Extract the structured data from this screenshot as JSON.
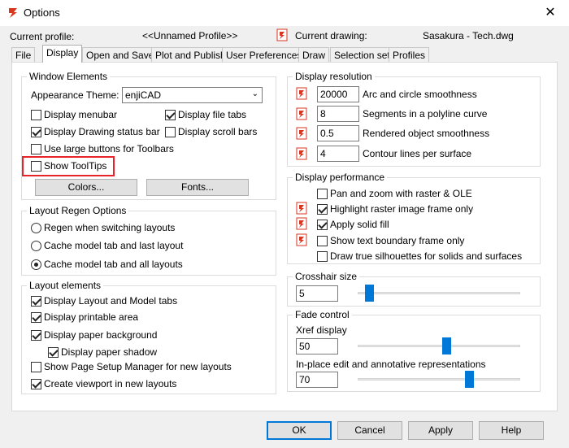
{
  "window": {
    "title": "Options",
    "close_glyph": "✕",
    "icon": "app-logo-icon"
  },
  "profile": {
    "current_profile_label": "Current profile:",
    "current_profile_value": "<<Unnamed Profile>>",
    "current_drawing_label": "Current drawing:",
    "current_drawing_value": "Sasakura - Tech.dwg"
  },
  "tabs": [
    "File",
    "Display",
    "Open and Save",
    "Plot and Publish",
    "User Preferences",
    "Draw",
    "Selection set",
    "Profiles"
  ],
  "active_tab": "Display",
  "window_elements": {
    "title": "Window Elements",
    "appearance_theme_label": "Appearance Theme:",
    "appearance_theme_value": "enjiCAD",
    "display_menubar": {
      "label": "Display menubar",
      "checked": false
    },
    "display_file_tabs": {
      "label": "Display file tabs",
      "checked": true
    },
    "display_drawing_status_bar": {
      "label": "Display Drawing status bar",
      "checked": true
    },
    "display_scroll_bars": {
      "label": "Display scroll bars",
      "checked": false
    },
    "use_large_buttons": {
      "label": "Use large buttons for Toolbars",
      "checked": false
    },
    "show_tooltips": {
      "label": "Show ToolTips",
      "checked": false
    },
    "colors_button": "Colors...",
    "fonts_button": "Fonts..."
  },
  "layout_regen": {
    "title": "Layout Regen Options",
    "options": [
      {
        "label": "Regen when switching layouts",
        "selected": false
      },
      {
        "label": "Cache model tab and last layout",
        "selected": false
      },
      {
        "label": "Cache model tab and all layouts",
        "selected": true
      }
    ]
  },
  "layout_elements": {
    "title": "Layout elements",
    "display_layout_model_tabs": {
      "label": "Display Layout and Model tabs",
      "checked": true
    },
    "display_printable_area": {
      "label": "Display printable area",
      "checked": true
    },
    "display_paper_background": {
      "label": "Display paper background",
      "checked": true
    },
    "display_paper_shadow": {
      "label": "Display paper shadow",
      "checked": true
    },
    "show_page_setup_manager": {
      "label": "Show Page Setup Manager for new layouts",
      "checked": false
    },
    "create_viewport": {
      "label": "Create viewport in new layouts",
      "checked": true
    }
  },
  "display_resolution": {
    "title": "Display resolution",
    "items": [
      {
        "value": "20000",
        "label": "Arc and circle smoothness"
      },
      {
        "value": "8",
        "label": "Segments in a polyline curve"
      },
      {
        "value": "0.5",
        "label": "Rendered object smoothness"
      },
      {
        "value": "4",
        "label": "Contour lines per surface"
      }
    ]
  },
  "display_performance": {
    "title": "Display performance",
    "items": [
      {
        "label": "Pan and zoom with raster & OLE",
        "checked": false
      },
      {
        "label": "Highlight raster image frame only",
        "checked": true
      },
      {
        "label": "Apply solid fill",
        "checked": true
      },
      {
        "label": "Show text boundary frame only",
        "checked": false
      },
      {
        "label": "Draw true silhouettes for solids and surfaces",
        "checked": false
      }
    ]
  },
  "crosshair": {
    "title": "Crosshair size",
    "value": "5",
    "slider_fraction": 0.05
  },
  "fade_control": {
    "title": "Fade control",
    "xref_label": "Xref display",
    "xref_value": "50",
    "xref_fraction": 0.55,
    "inplace_label": "In-place edit and annotative representations",
    "inplace_value": "70",
    "inplace_fraction": 0.7
  },
  "buttons": {
    "ok": "OK",
    "cancel": "Cancel",
    "apply": "Apply",
    "help": "Help"
  },
  "colors": {
    "accent": "#0078d7",
    "highlight": "#e8232a",
    "app_icon": "#d9361f"
  }
}
